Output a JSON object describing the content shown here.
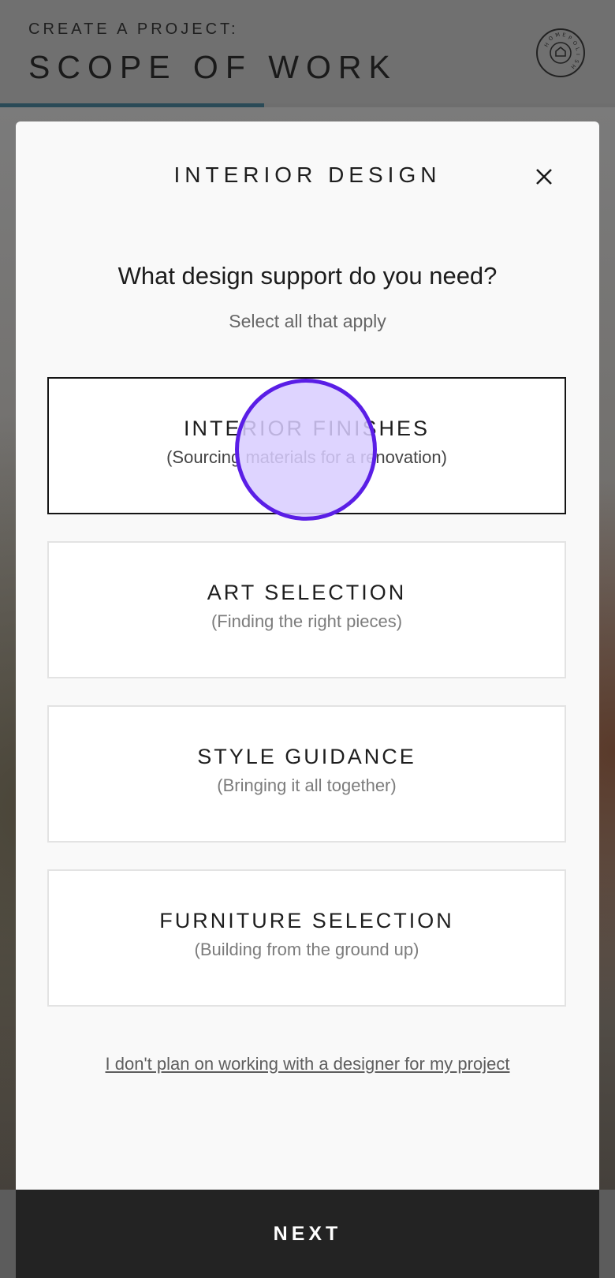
{
  "header": {
    "kicker": "CREATE A PROJECT:",
    "title": "SCOPE OF WORK",
    "logo_text": "HOMEPOLISH",
    "progress_fraction": 0.43
  },
  "modal": {
    "title": "INTERIOR DESIGN",
    "close_icon": "close-icon",
    "question": "What design support do you need?",
    "hint": "Select all that apply",
    "options": [
      {
        "label": "INTERIOR FINISHES",
        "description": "(Sourcing materials for a renovation)",
        "selected": true
      },
      {
        "label": "ART SELECTION",
        "description": "(Finding the right pieces)",
        "selected": false
      },
      {
        "label": "STYLE GUIDANCE",
        "description": "(Bringing it all together)",
        "selected": false
      },
      {
        "label": "FURNITURE SELECTION",
        "description": "(Building from the ground up)",
        "selected": false
      }
    ],
    "optout_link": "I don't plan on working with a designer for my project"
  },
  "footer": {
    "next_label": "NEXT"
  },
  "colors": {
    "accent_progress": "#2a4a57",
    "selected_border": "#151515",
    "touch_indicator": "#5a1ee6",
    "next_bg": "#232323"
  }
}
